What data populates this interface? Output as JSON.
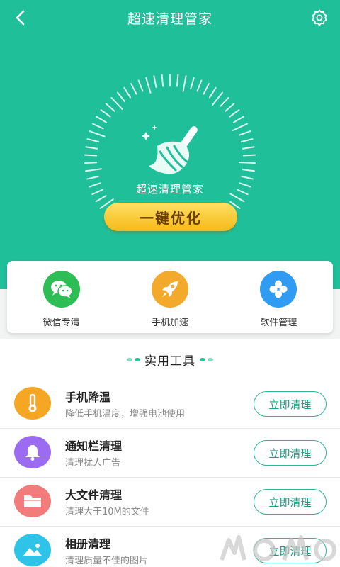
{
  "app": {
    "title": "超速清理管家"
  },
  "hero": {
    "caption": "超速清理管家",
    "optimize_label": "一键优化"
  },
  "quick_actions": [
    {
      "label": "微信专清",
      "icon": "wechat-icon",
      "color": "#2dbd55"
    },
    {
      "label": "手机加速",
      "icon": "rocket-icon",
      "color": "#f3a92b"
    },
    {
      "label": "软件管理",
      "icon": "apps-icon",
      "color": "#2f9bf2"
    }
  ],
  "section": {
    "title": "实用工具"
  },
  "tools": [
    {
      "name": "手机降温",
      "desc": "降低手机温度，增强电池使用",
      "button": "立即清理",
      "icon": "thermometer-icon",
      "color": "#f5a623"
    },
    {
      "name": "通知栏清理",
      "desc": "清理扰人广告",
      "button": "立即清理",
      "icon": "bell-icon",
      "color": "#9b6cf2"
    },
    {
      "name": "大文件清理",
      "desc": "清理大于10M的文件",
      "button": "立即清理",
      "icon": "folder-icon",
      "color": "#f27b7b"
    },
    {
      "name": "相册清理",
      "desc": "清理质量不佳的图片",
      "button": "立即清理",
      "icon": "photo-icon",
      "color": "#2fc3e8"
    }
  ],
  "colors": {
    "primary": "#1fbf9a",
    "accent": "#f6b919",
    "outline": "#2cb596"
  }
}
